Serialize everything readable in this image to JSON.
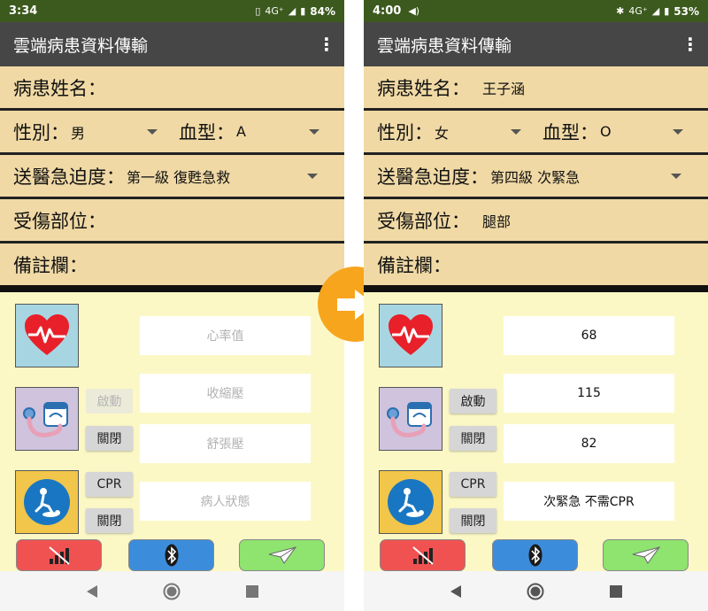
{
  "left": {
    "status": {
      "time": "3:34",
      "network": "4G⁺",
      "battery": "84%"
    },
    "appbar": {
      "title": "雲端病患資料傳輸"
    },
    "form": {
      "name_label": "病患姓名：",
      "name_value": "",
      "gender_label": "性別：",
      "gender_value": "男",
      "blood_label": "血型：",
      "blood_value": "A",
      "urgency_label": "送醫急迫度：",
      "urgency_value": "第一級 復甦急救",
      "injury_label": "受傷部位：",
      "injury_value": "",
      "notes_label": "備註欄：",
      "notes_value": ""
    },
    "vitals": {
      "heart_rate": "心率值",
      "systolic": "收縮壓",
      "diastolic": "舒張壓",
      "patient_status": "病人狀態"
    },
    "buttons": {
      "start": "啟動",
      "close_bp": "關閉",
      "cpr": "CPR",
      "close_cpr": "關閉"
    }
  },
  "right": {
    "status": {
      "time": "4:00",
      "network": "4G⁺",
      "battery": "53%"
    },
    "appbar": {
      "title": "雲端病患資料傳輸"
    },
    "form": {
      "name_label": "病患姓名：",
      "name_value": "王子涵",
      "gender_label": "性別：",
      "gender_value": "女",
      "blood_label": "血型：",
      "blood_value": "O",
      "urgency_label": "送醫急迫度：",
      "urgency_value": "第四級 次緊急",
      "injury_label": "受傷部位：",
      "injury_value": "腿部",
      "notes_label": "備註欄：",
      "notes_value": ""
    },
    "vitals": {
      "heart_rate": "68",
      "systolic": "115",
      "diastolic": "82",
      "patient_status": "次緊急 不需CPR"
    },
    "buttons": {
      "start": "啟動",
      "close_bp": "關閉",
      "cpr": "CPR",
      "close_cpr": "關閉"
    }
  },
  "colors": {
    "status_bar": "#3c5a1e",
    "app_bar": "#464646",
    "form_row": "#f0d9a5",
    "panel_bg": "#fbf8c6",
    "arrow_badge": "#f7a51c",
    "btn_red": "#f05252",
    "btn_blue": "#3c8cdc",
    "btn_green": "#8fe36f"
  },
  "icons": {
    "signal_off": "no-signal-icon",
    "bluetooth": "bluetooth-icon",
    "send": "paper-plane-icon",
    "heart": "heart-pulse-icon",
    "blood_pressure": "blood-pressure-monitor-icon",
    "cpr": "cpr-icon",
    "transition": "right-arrow-icon"
  }
}
